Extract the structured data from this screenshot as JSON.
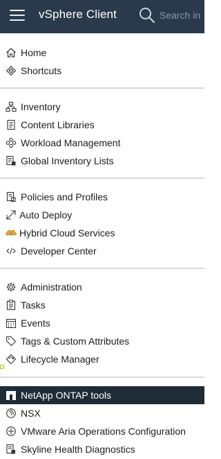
{
  "header": {
    "app_title": "vSphere Client",
    "search_placeholder": "Search in"
  },
  "groups": [
    {
      "items": [
        {
          "label": "Home",
          "icon": "home-icon"
        },
        {
          "label": "Shortcuts",
          "icon": "shortcuts-icon"
        }
      ]
    },
    {
      "items": [
        {
          "label": "Inventory",
          "icon": "inventory-icon"
        },
        {
          "label": "Content Libraries",
          "icon": "content-libraries-icon"
        },
        {
          "label": "Workload Management",
          "icon": "workload-management-icon"
        },
        {
          "label": "Global Inventory Lists",
          "icon": "global-inventory-icon"
        }
      ]
    },
    {
      "items": [
        {
          "label": "Policies and Profiles",
          "icon": "policies-icon"
        },
        {
          "label": "Auto Deploy",
          "icon": "auto-deploy-icon"
        },
        {
          "label": "Hybrid Cloud Services",
          "icon": "hybrid-cloud-icon"
        },
        {
          "label": "Developer Center",
          "icon": "developer-center-icon"
        }
      ]
    },
    {
      "items": [
        {
          "label": "Administration",
          "icon": "administration-icon"
        },
        {
          "label": "Tasks",
          "icon": "tasks-icon"
        },
        {
          "label": "Events",
          "icon": "events-icon"
        },
        {
          "label": "Tags & Custom Attributes",
          "icon": "tag-icon"
        },
        {
          "label": "Lifecycle Manager",
          "icon": "lifecycle-manager-icon"
        }
      ]
    },
    {
      "items": [
        {
          "label": "NetApp ONTAP tools",
          "icon": "netapp-icon",
          "active": true
        },
        {
          "label": "NSX",
          "icon": "nsx-icon"
        },
        {
          "label": "VMware Aria Operations Configuration",
          "icon": "aria-operations-icon"
        },
        {
          "label": "Skyline Health Diagnostics",
          "icon": "skyline-health-icon"
        }
      ]
    }
  ],
  "colors": {
    "topbar": "#2b3a4a",
    "active_row": "#1f2b36",
    "divider": "#d6d9dc",
    "hybrid_cloud_accent": "#f5a623"
  }
}
